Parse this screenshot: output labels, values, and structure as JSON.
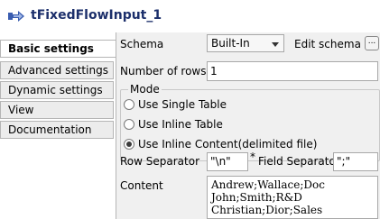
{
  "window": {
    "title": "tFixedFlowInput_1",
    "icon": "component-arrow-icon"
  },
  "sidebar": {
    "items": [
      {
        "label": "Basic settings"
      },
      {
        "label": "Advanced settings"
      },
      {
        "label": "Dynamic settings"
      },
      {
        "label": "View"
      },
      {
        "label": "Documentation"
      }
    ]
  },
  "main": {
    "schema_label": "Schema",
    "schema_value": "Built-In",
    "edit_schema_label": "Edit schema",
    "edit_schema_button": "...",
    "rows_label": "Number of rows",
    "rows_value": "1",
    "mode": {
      "title": "Mode",
      "options": [
        {
          "label": "Use Single Table",
          "selected": false
        },
        {
          "label": "Use Inline Table",
          "selected": false
        },
        {
          "label": "Use Inline Content(delimited file)",
          "selected": true
        }
      ]
    },
    "row_sep_label": "Row Separator",
    "row_sep_value": "\"\\n\"",
    "required_mark": "*",
    "field_sep_label": "Field Separator",
    "field_sep_value": "\";\"",
    "content_label": "Content",
    "content_value": "Andrew;Wallace;Doc\nJohn;Smith;R&D\nChristian;Dior;Sales"
  }
}
